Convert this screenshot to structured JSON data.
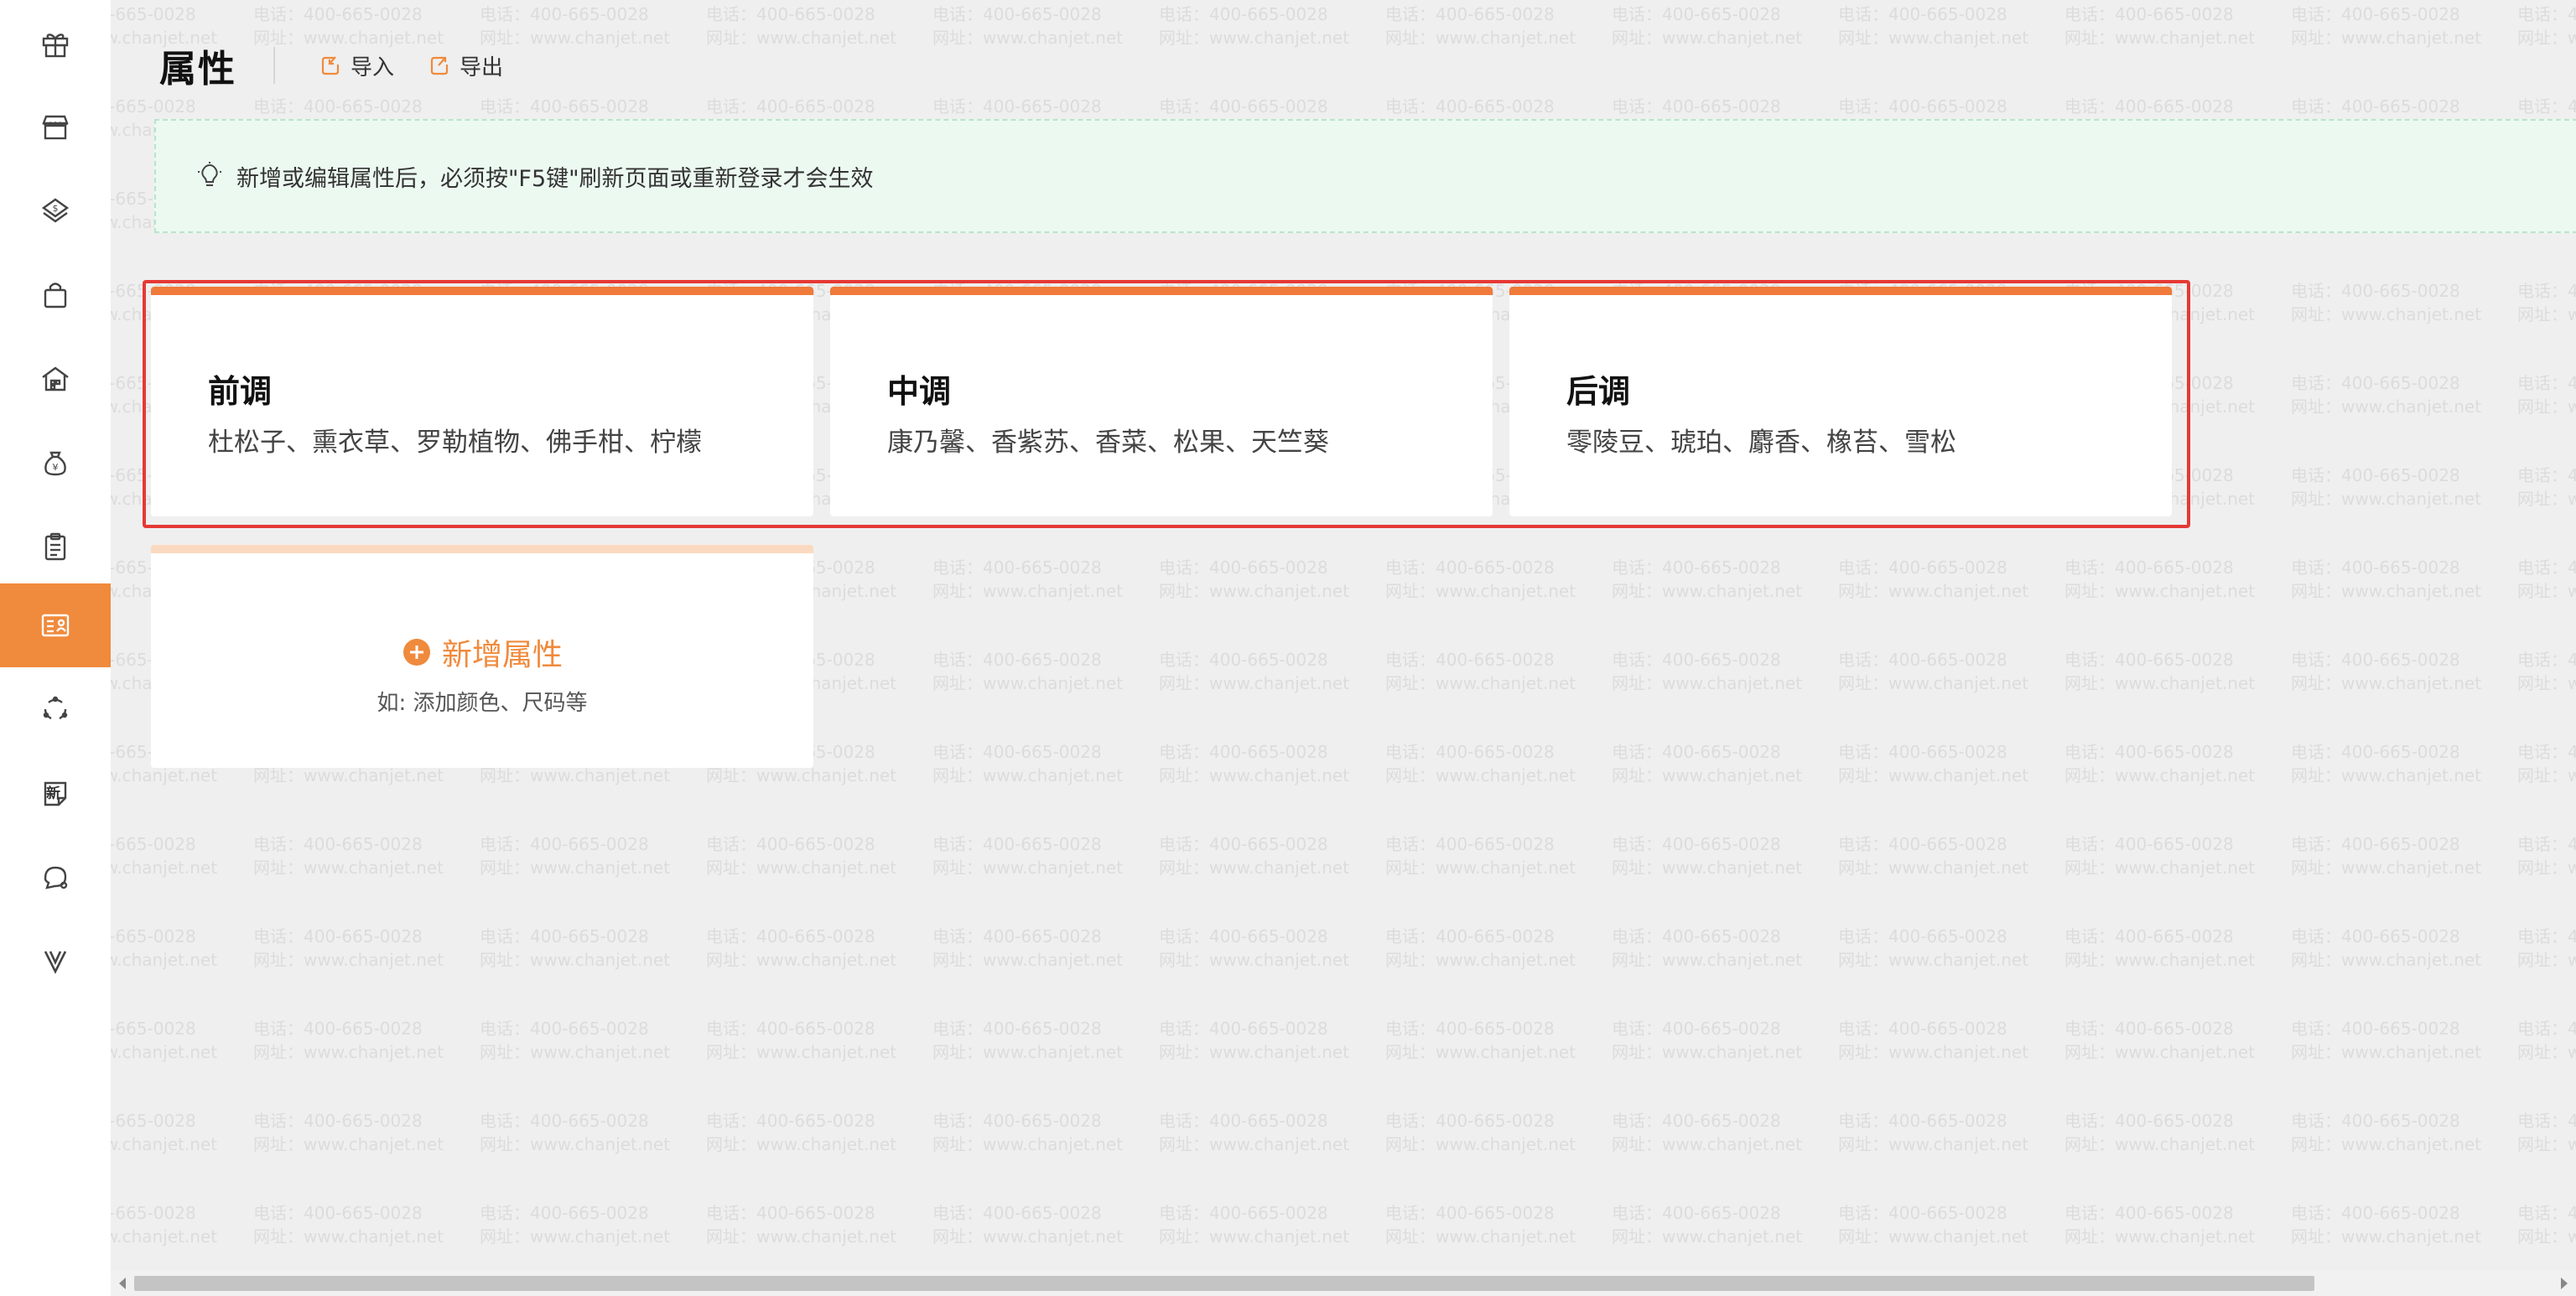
{
  "sidebar": {
    "items": [
      {
        "icon": "gift-icon"
      },
      {
        "icon": "store-icon"
      },
      {
        "icon": "dollar-box-icon"
      },
      {
        "icon": "shopping-bag-icon"
      },
      {
        "icon": "warehouse-icon"
      },
      {
        "icon": "money-bag-icon"
      },
      {
        "icon": "clipboard-icon"
      },
      {
        "icon": "attribute-card-icon",
        "active": true
      },
      {
        "icon": "cycle-icon"
      },
      {
        "icon": "new-badge-icon",
        "label": "新"
      },
      {
        "icon": "chat-icon"
      },
      {
        "icon": "v-logo-icon"
      }
    ]
  },
  "header": {
    "title": "属性",
    "import_label": "导入",
    "export_label": "导出"
  },
  "notice": {
    "text": "新增或编辑属性后，必须按\"F5键\"刷新页面或重新登录才会生效"
  },
  "attributes": [
    {
      "name": "前调",
      "values": "杜松子、熏衣草、罗勒植物、佛手柑、柠檬"
    },
    {
      "name": "中调",
      "values": "康乃馨、香紫苏、香菜、松果、天竺葵"
    },
    {
      "name": "后调",
      "values": "零陵豆、琥珀、麝香、橡苔、雪松"
    }
  ],
  "add_card": {
    "label": "新增属性",
    "hint": "如: 添加颜色、尺码等"
  },
  "watermark": {
    "phone": "电话：400-665-0028",
    "site": "网址：www.chanjet.net"
  },
  "colors": {
    "accent": "#f08a3c",
    "card_top": "#f07a3a",
    "highlight_frame": "#e53935",
    "notice_bg": "#ecf9f1"
  }
}
